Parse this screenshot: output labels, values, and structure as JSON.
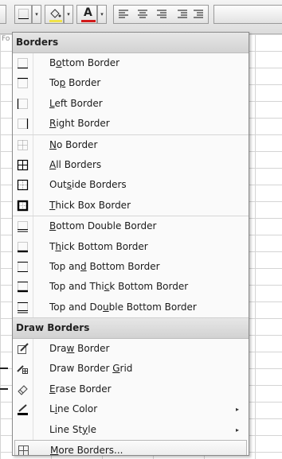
{
  "window": {
    "partial_text_left": "Fo"
  },
  "toolbar": {
    "font_color_letter": "A",
    "dropdown_glyph": "▾"
  },
  "menu": {
    "header_borders": "Borders",
    "header_draw": "Draw Borders",
    "submenu_arrow": "▸",
    "items": [
      {
        "key": "bottom",
        "pre": "B",
        "acc": "o",
        "post": "ttom Border",
        "icon": "border-bottom-icon"
      },
      {
        "key": "top",
        "pre": "To",
        "acc": "p",
        "post": " Border",
        "icon": "border-top-icon"
      },
      {
        "key": "left",
        "pre": "",
        "acc": "L",
        "post": "eft Border",
        "icon": "border-left-icon"
      },
      {
        "key": "right",
        "pre": "",
        "acc": "R",
        "post": "ight Border",
        "icon": "border-right-icon"
      },
      {
        "key": "none",
        "pre": "",
        "acc": "N",
        "post": "o Border",
        "icon": "no-border-icon"
      },
      {
        "key": "all",
        "pre": "",
        "acc": "A",
        "post": "ll Borders",
        "icon": "all-borders-icon"
      },
      {
        "key": "outside",
        "pre": "Out",
        "acc": "s",
        "post": "ide Borders",
        "icon": "outside-borders-icon"
      },
      {
        "key": "thickbox",
        "pre": "",
        "acc": "T",
        "post": "hick Box Border",
        "icon": "thick-box-border-icon"
      },
      {
        "key": "bottomdouble",
        "pre": "",
        "acc": "B",
        "post": "ottom Double Border",
        "icon": "bottom-double-border-icon"
      },
      {
        "key": "thickbottom",
        "pre": "T",
        "acc": "h",
        "post": "ick Bottom Border",
        "icon": "thick-bottom-border-icon"
      },
      {
        "key": "topbottom",
        "pre": "Top an",
        "acc": "d",
        "post": " Bottom Border",
        "icon": "top-bottom-border-icon"
      },
      {
        "key": "topthickbottom",
        "pre": "Top and Thi",
        "acc": "c",
        "post": "k Bottom Border",
        "icon": "top-thick-bottom-border-icon"
      },
      {
        "key": "topdoublebottom",
        "pre": "Top and Do",
        "acc": "u",
        "post": "ble Bottom Border",
        "icon": "top-double-bottom-border-icon"
      },
      {
        "key": "draw",
        "pre": "Dra",
        "acc": "w",
        "post": " Border",
        "icon": "draw-border-icon"
      },
      {
        "key": "drawgrid",
        "pre": "Draw Border ",
        "acc": "G",
        "post": "rid",
        "icon": "draw-border-grid-icon"
      },
      {
        "key": "erase",
        "pre": "",
        "acc": "E",
        "post": "rase Border",
        "icon": "eraser-icon"
      },
      {
        "key": "linecolor",
        "pre": "L",
        "acc": "i",
        "post": "ne Color",
        "icon": "line-color-icon"
      },
      {
        "key": "linestyle",
        "pre": "Line St",
        "acc": "y",
        "post": "le",
        "icon": ""
      },
      {
        "key": "more",
        "pre": "",
        "acc": "M",
        "post": "ore Borders...",
        "icon": "more-borders-icon"
      }
    ]
  },
  "colors": {
    "line_color_swatch": "#000000",
    "font_color": "#d21b1b",
    "fill_color": "#f0e34a"
  }
}
